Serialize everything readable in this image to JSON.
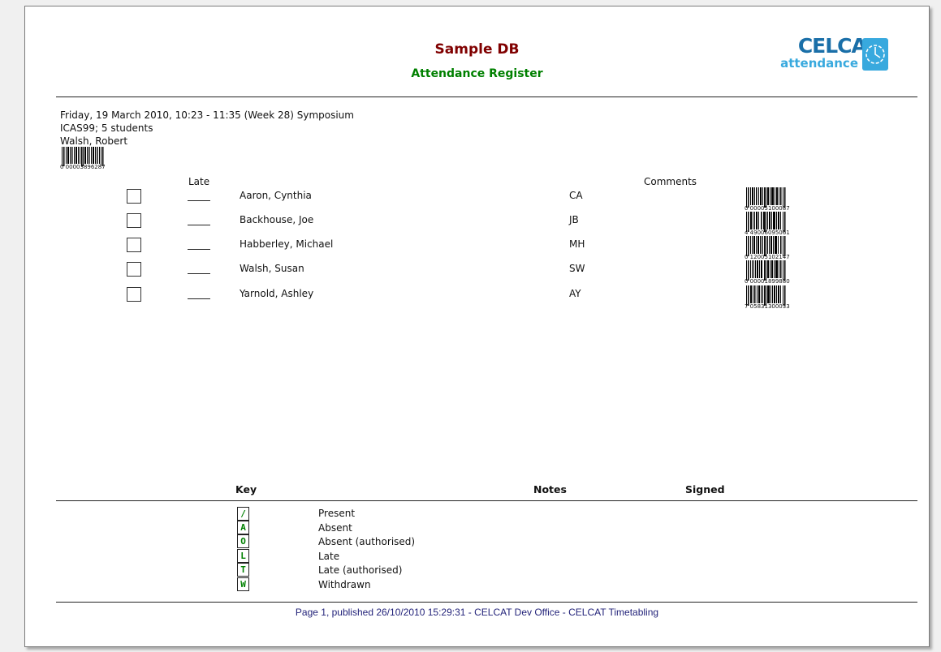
{
  "header": {
    "title": "Sample DB",
    "subtitle": "Attendance Register",
    "logo": {
      "word1": "CELCAT",
      "word2": "attendance",
      "colors": {
        "dark": "#1a6fa8",
        "light": "#38a9de"
      }
    }
  },
  "session": {
    "line1": "Friday, 19 March 2010, 10:23 - 11:35 (Week 28) Symposium",
    "line2": "ICAS99; 5 students",
    "line3": "Walsh, Robert",
    "barcode_text": "0 00003896287"
  },
  "columns": {
    "late": "Late",
    "comments": "Comments"
  },
  "students": [
    {
      "name": "Aaron, Cynthia",
      "initials": "CA",
      "barcode": "0 00005100087"
    },
    {
      "name": "Backhouse, Joe",
      "initials": "JB",
      "barcode": "4 49006095061"
    },
    {
      "name": "Habberley, Michael",
      "initials": "MH",
      "barcode": "0 12005102147"
    },
    {
      "name": "Walsh, Susan",
      "initials": "SW",
      "barcode": "0 00001899880"
    },
    {
      "name": "Yarnold, Ashley",
      "initials": "AY",
      "barcode": "7 05831300033"
    }
  ],
  "key_section": {
    "key_label": "Key",
    "notes_label": "Notes",
    "signed_label": "Signed",
    "items": [
      {
        "code": "/",
        "label": "Present"
      },
      {
        "code": "A",
        "label": "Absent"
      },
      {
        "code": "O",
        "label": "Absent (authorised)"
      },
      {
        "code": "L",
        "label": "Late"
      },
      {
        "code": "T",
        "label": "Late (authorised)"
      },
      {
        "code": "W",
        "label": "Withdrawn"
      }
    ]
  },
  "footer": {
    "text": "Page 1, published 26/10/2010 15:29:31 - CELCAT Dev Office - CELCAT Timetabling"
  },
  "colors": {
    "title": "#800000",
    "subtitle": "#008000",
    "footer": "#23237a"
  }
}
